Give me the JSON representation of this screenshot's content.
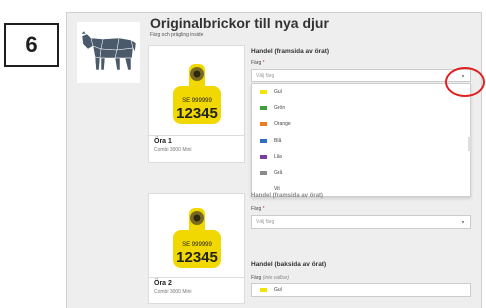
{
  "step": {
    "number": "6"
  },
  "header": {
    "title": "Originalbrickor till nya djur",
    "subtitle": "Färg och prägling inside"
  },
  "cards": [
    {
      "name": "Öra 1",
      "product": "Combi 3000 Mini",
      "tag_country": "SE 999999",
      "tag_number": "12345"
    },
    {
      "name": "Öra 2",
      "product": "Combi 3000 Mini",
      "tag_country": "SE 999999",
      "tag_number": "12345"
    }
  ],
  "front": {
    "heading": "Handel (framsida av örat)",
    "color_label": "Färg",
    "required_mark": "*",
    "color_placeholder": "Välj färg",
    "options": [
      {
        "label": "Gul",
        "color": "#f2e600"
      },
      {
        "label": "Grön",
        "color": "#3f9f3a"
      },
      {
        "label": "Orange",
        "color": "#ee7d1a"
      },
      {
        "label": "Blå",
        "color": "#2f6fc0"
      },
      {
        "label": "Lila",
        "color": "#7a3fa0"
      },
      {
        "label": "Grå",
        "color": "#8a8a8a"
      },
      {
        "label": "Vit",
        "color": "#ffffff"
      }
    ]
  },
  "second_front": {
    "heading_partial": "Handel (framsida av örat)",
    "color_label": "Färg",
    "required_mark": "*",
    "color_placeholder": "Välj färg"
  },
  "back": {
    "heading": "Handel (baksida av örat)",
    "color_label": "Färg",
    "color_note": "(inte valbar)",
    "value": "Gul",
    "value_color": "#f2e600"
  },
  "colors": {
    "tag_yellow": "#f0d800",
    "highlight": "#e02020",
    "frame_bg": "#eeeeee"
  }
}
